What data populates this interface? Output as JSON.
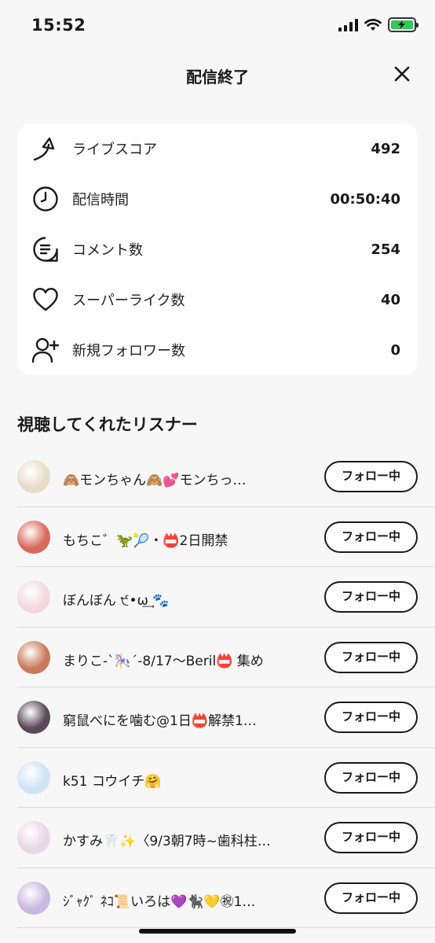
{
  "status_bar": {
    "time": "15:52"
  },
  "header": {
    "title": "配信終了"
  },
  "stats": [
    {
      "label": "ライブスコア",
      "value": "492",
      "icon": "arrow-up-icon"
    },
    {
      "label": "配信時間",
      "value": "00:50:40",
      "icon": "clock-icon"
    },
    {
      "label": "コメント数",
      "value": "254",
      "icon": "comment-icon"
    },
    {
      "label": "スーパーライク数",
      "value": "40",
      "icon": "heart-icon"
    },
    {
      "label": "新規フォロワー数",
      "value": "0",
      "icon": "user-plus-icon"
    }
  ],
  "section_title": "視聴してくれたリスナー",
  "listeners": [
    {
      "name": "🙈モンちゃん🙈💕モンちっ…",
      "button": "フォロー中",
      "avatar_color": "#e8dcc8"
    },
    {
      "name": "もちこ゛🦖🎾・📛2日開禁",
      "button": "フォロー中",
      "avatar_color": "#d86a5a"
    },
    {
      "name": "ぼんぼん ੯•ω͢ 🐾",
      "button": "フォロー中",
      "avatar_color": "#f3d8e0"
    },
    {
      "name": "まりこ-ˋ🎠ˊ-8/17〜Beril📛 集め",
      "button": "フォロー中",
      "avatar_color": "#c97a5a"
    },
    {
      "name": "窮鼠べにを噛む@1日📛解禁1…",
      "button": "フォロー中",
      "avatar_color": "#5a4a5a"
    },
    {
      "name": "k51 コウイチ🤗",
      "button": "フォロー中",
      "avatar_color": "#cfe3f5"
    },
    {
      "name": "かすみ🦷✨〈9/3朝7時~歯科柱…",
      "button": "フォロー中",
      "avatar_color": "#e9d6e6"
    },
    {
      "name": "ｼﾞｬｸﾞ ﾈｺ📜いろは💜🐈‍⬛💛㊗1…",
      "button": "フォロー中",
      "avatar_color": "#c9b8e0"
    }
  ]
}
